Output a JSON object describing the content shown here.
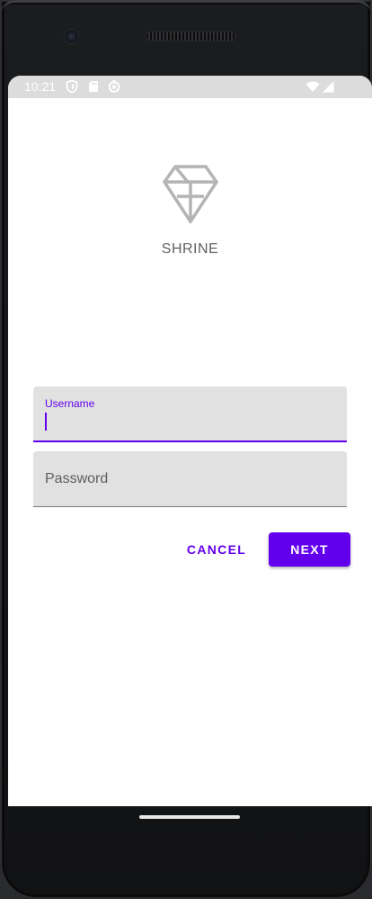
{
  "status_bar": {
    "time": "10:21",
    "icons": [
      "shield-icon",
      "sd-card-icon",
      "sync-icon",
      "wifi-icon",
      "cellular-signal-icon"
    ]
  },
  "app": {
    "brand": "SHRINE",
    "logo_icon": "diamond-icon"
  },
  "form": {
    "username": {
      "label": "Username",
      "value": ""
    },
    "password": {
      "placeholder": "Password",
      "value": ""
    }
  },
  "actions": {
    "cancel_label": "CANCEL",
    "next_label": "NEXT"
  },
  "colors": {
    "primary": "#6200ee",
    "field_background": "#e1e1e1",
    "status_bar": "#dcdcdd"
  }
}
